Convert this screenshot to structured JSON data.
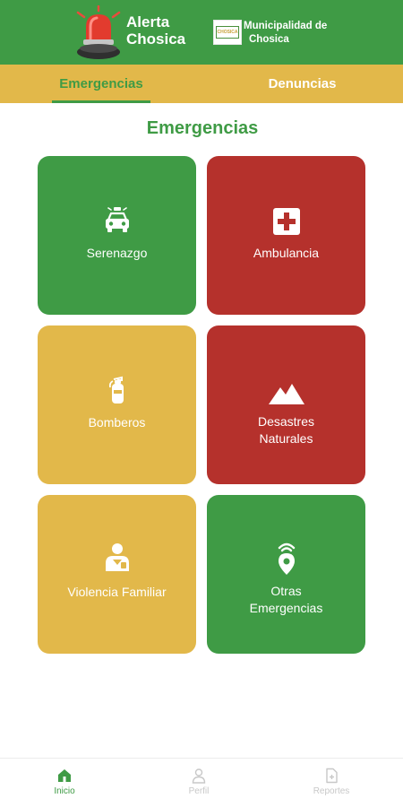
{
  "header": {
    "app_title_line1": "Alerta",
    "app_title_line2": "Chosica",
    "muni_line1": "Municipalidad de",
    "muni_line2": "Chosica",
    "logo_text": "CHOSICA",
    "icons": {
      "app": "siren-icon",
      "municipality": "municipality-logo"
    }
  },
  "tabs": [
    {
      "label": "Emergencias",
      "active": true
    },
    {
      "label": "Denuncias",
      "active": false
    }
  ],
  "section_title": "Emergencias",
  "cards": [
    {
      "label": "Serenazgo",
      "icon": "patrol-car-icon",
      "color": "#3f9b45"
    },
    {
      "label": "Ambulancia",
      "icon": "medical-cross-icon",
      "color": "#b5312c"
    },
    {
      "label": "Bomberos",
      "icon": "fire-extinguisher-icon",
      "color": "#e2b84a"
    },
    {
      "label_line1": "Desastres",
      "label_line2": "Naturales",
      "icon": "mountain-icon",
      "color": "#b5312c"
    },
    {
      "label": "Violencia Familiar",
      "icon": "person-icon",
      "color": "#e2b84a"
    },
    {
      "label_line1": "Otras",
      "label_line2": "Emergencias",
      "icon": "location-signal-icon",
      "color": "#3f9b45"
    }
  ],
  "bottom_nav": [
    {
      "label": "Inicio",
      "icon": "home-icon",
      "active": true
    },
    {
      "label": "Perfil",
      "icon": "user-icon",
      "active": false
    },
    {
      "label": "Reportes",
      "icon": "document-icon",
      "active": false
    }
  ],
  "colors": {
    "primary_green": "#3f9b45",
    "accent_yellow": "#e2b84a",
    "alert_red": "#b5312c",
    "inactive_gray": "#c8c8c8"
  }
}
